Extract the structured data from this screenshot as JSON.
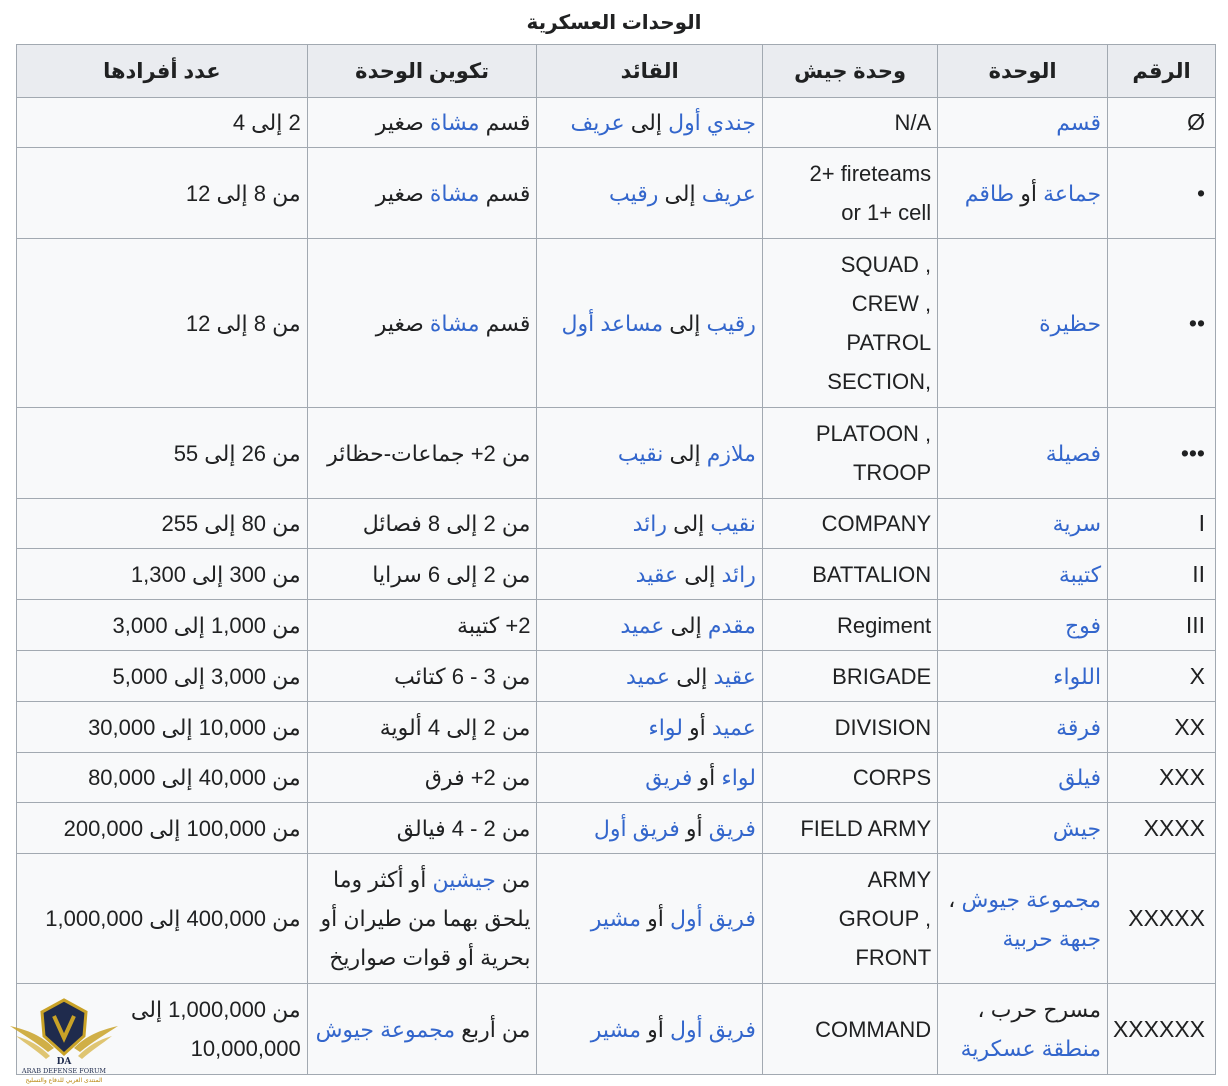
{
  "caption": "الوحدات العسكرية",
  "headers": [
    "الرقم",
    "الوحدة",
    "وحدة جيش",
    "القائد",
    "تكوين الوحدة",
    "عدد أفرادها"
  ],
  "rows": [
    {
      "h": 50,
      "num": "Ø",
      "unit": [
        [
          "l",
          "قسم"
        ]
      ],
      "army": [
        [
          "FN/A"
        ]
      ],
      "leader": [
        [
          "l",
          "جندي أول"
        ],
        [
          "t",
          " إلى "
        ],
        [
          "l",
          "عريف"
        ]
      ],
      "form": [
        [
          "t",
          "قسم "
        ],
        [
          "l",
          "مشاة"
        ],
        [
          "t",
          " صغير"
        ]
      ],
      "size": [
        [
          "t",
          "2 إلى 4"
        ]
      ]
    },
    {
      "h": 91,
      "num": "•",
      "unit": [
        [
          "l",
          "جماعة"
        ],
        [
          "t",
          " أو "
        ],
        [
          "l",
          "طاقم"
        ]
      ],
      "army": [
        [
          "2+ fireteams"
        ],
        [
          "or 1+ cell"
        ]
      ],
      "leader": [
        [
          "l",
          "عريف"
        ],
        [
          "t",
          " إلى "
        ],
        [
          "l",
          "رقيب"
        ]
      ],
      "form": [
        [
          "t",
          "قسم "
        ],
        [
          "l",
          "مشاة"
        ],
        [
          "t",
          " صغير"
        ]
      ],
      "size": [
        [
          "t",
          "من 8 إلى 12"
        ]
      ]
    },
    {
      "h": 169,
      "num": "••",
      "unit": [
        [
          "l",
          "حظيرة"
        ]
      ],
      "army": [
        [
          "SQUAD ,"
        ],
        [
          "CREW ,"
        ],
        [
          "PATROL"
        ],
        [
          "SECTION,"
        ]
      ],
      "leader": [
        [
          "l",
          "رقيب"
        ],
        [
          "t",
          " إلى "
        ],
        [
          "l",
          "مساعد أول"
        ]
      ],
      "form": [
        [
          "t",
          "قسم "
        ],
        [
          "l",
          "مشاة"
        ],
        [
          "t",
          " صغير"
        ]
      ],
      "size": [
        [
          "t",
          "من 8 إلى 12"
        ]
      ]
    },
    {
      "h": 91,
      "num": "•••",
      "unit": [
        [
          "l",
          "فصيلة"
        ]
      ],
      "army": [
        [
          "PLATOON ,"
        ],
        [
          "TROOP"
        ]
      ],
      "leader": [
        [
          "l",
          "ملازم"
        ],
        [
          "t",
          " إلى "
        ],
        [
          "l",
          "نقيب"
        ]
      ],
      "form": [
        [
          "t",
          "من 2+ جماعات-حظائر"
        ]
      ],
      "size": [
        [
          "t",
          "من 26 إلى 55"
        ]
      ]
    },
    {
      "h": 50,
      "num": "I",
      "unit": [
        [
          "l",
          "سرية"
        ]
      ],
      "army": [
        [
          "COMPANY"
        ]
      ],
      "leader": [
        [
          "l",
          "نقيب"
        ],
        [
          "t",
          " إلى "
        ],
        [
          "l",
          "رائد"
        ]
      ],
      "form": [
        [
          "t",
          "من 2 إلى 8 فصائل"
        ]
      ],
      "size": [
        [
          "t",
          "من 80 إلى 255"
        ]
      ]
    },
    {
      "h": 51,
      "num": "II",
      "unit": [
        [
          "l",
          "كتيبة"
        ]
      ],
      "army": [
        [
          "BATTALION"
        ]
      ],
      "leader": [
        [
          "l",
          "رائد"
        ],
        [
          "t",
          " إلى "
        ],
        [
          "l",
          "عقيد"
        ]
      ],
      "form": [
        [
          "t",
          "من 2 إلى 6 سرايا"
        ]
      ],
      "size": [
        [
          "t",
          "من 300 إلى 1,300"
        ]
      ]
    },
    {
      "h": 51,
      "num": "III",
      "unit": [
        [
          "l",
          "فوج"
        ]
      ],
      "army": [
        [
          "Regiment"
        ]
      ],
      "leader": [
        [
          "l",
          "مقدم"
        ],
        [
          "t",
          " إلى "
        ],
        [
          "l",
          "عميد"
        ]
      ],
      "form": [
        [
          "t",
          "2+ كتيبة"
        ]
      ],
      "size": [
        [
          "t",
          "من 1,000 إلى 3,000"
        ]
      ]
    },
    {
      "h": 51,
      "num": "X",
      "unit": [
        [
          "l",
          "اللواء"
        ]
      ],
      "army": [
        [
          "BRIGADE"
        ]
      ],
      "leader": [
        [
          "l",
          "عقيد"
        ],
        [
          "t",
          " إلى "
        ],
        [
          "l",
          "عميد"
        ]
      ],
      "form": [
        [
          "t",
          "من 3 - 6 كتائب"
        ]
      ],
      "size": [
        [
          "t",
          "من 3,000 إلى 5,000"
        ]
      ]
    },
    {
      "h": 51,
      "num": "XX",
      "unit": [
        [
          "l",
          "فرقة"
        ]
      ],
      "army": [
        [
          "DIVISION"
        ]
      ],
      "leader": [
        [
          "l",
          "عميد"
        ],
        [
          "t",
          " أو "
        ],
        [
          "l",
          "لواء"
        ]
      ],
      "form": [
        [
          "t",
          "من 2 إلى 4 ألوية"
        ]
      ],
      "size": [
        [
          "t",
          "من 10,000 إلى 30,000"
        ]
      ]
    },
    {
      "h": 50,
      "num": "XXX",
      "unit": [
        [
          "l",
          "فيلق"
        ]
      ],
      "army": [
        [
          "CORPS"
        ]
      ],
      "leader": [
        [
          "l",
          "لواء"
        ],
        [
          "t",
          " أو "
        ],
        [
          "l",
          "فريق"
        ]
      ],
      "form": [
        [
          "t",
          "من 2+ فرق"
        ]
      ],
      "size": [
        [
          "t",
          "من 40,000 إلى 80,000"
        ]
      ]
    },
    {
      "h": 51,
      "num": "XXXX",
      "unit": [
        [
          "l",
          "جيش"
        ]
      ],
      "army": [
        [
          "FIELD ARMY"
        ]
      ],
      "leader": [
        [
          "l",
          "فريق"
        ],
        [
          "t",
          " أو "
        ],
        [
          "l",
          "فريق أول"
        ]
      ],
      "form": [
        [
          "t",
          "من 2 - 4 فيالق"
        ]
      ],
      "size": [
        [
          "t",
          "من 100,000 إلى 200,000"
        ]
      ]
    },
    {
      "h": 130,
      "num": "XXXXX",
      "unit": [
        [
          "l",
          "مجموعة جيوش"
        ],
        [
          "t",
          " ، "
        ],
        [
          "l",
          "جبهة حربية"
        ]
      ],
      "army": [
        [
          "ARMY"
        ],
        [
          "GROUP ,"
        ],
        [
          "FRONT"
        ]
      ],
      "leader": [
        [
          "l",
          "فريق أول"
        ],
        [
          "t",
          " أو "
        ],
        [
          "l",
          "مشير"
        ]
      ],
      "form": [
        [
          "t",
          "من "
        ],
        [
          "l",
          "جيشين"
        ],
        [
          "t",
          " أو أكثر وما يلحق بهما من طيران أو بحرية أو قوات صواريخ"
        ]
      ],
      "size": [
        [
          "t",
          "من 400,000 إلى 1,000,000"
        ]
      ]
    },
    {
      "h": 91,
      "num": "XXXXXX",
      "unit": [
        [
          "t",
          "مسرح حرب ، "
        ],
        [
          "l",
          "منطقة عسكرية"
        ]
      ],
      "army": [
        [
          "COMMAND"
        ]
      ],
      "leader": [
        [
          "l",
          "فريق أول"
        ],
        [
          "t",
          " أو "
        ],
        [
          "l",
          "مشير"
        ]
      ],
      "form": [
        [
          "t",
          "من أربع "
        ],
        [
          "l",
          "مجموعة جيوش"
        ]
      ],
      "size": [
        [
          "t",
          "من 1,000,000 إلى 10,000,000"
        ]
      ]
    }
  ],
  "logo": {
    "mark": "DA",
    "line1": "ARAB DEFENSE FORUM",
    "line2": "المنتدى العربي للدفاع والتسليح"
  },
  "colors": {
    "link": "#3366cc",
    "header_bg": "#eaecf0",
    "cell_bg": "#f8f9fa",
    "border": "#a2a9b1",
    "logo_gold": "#b8860b"
  }
}
